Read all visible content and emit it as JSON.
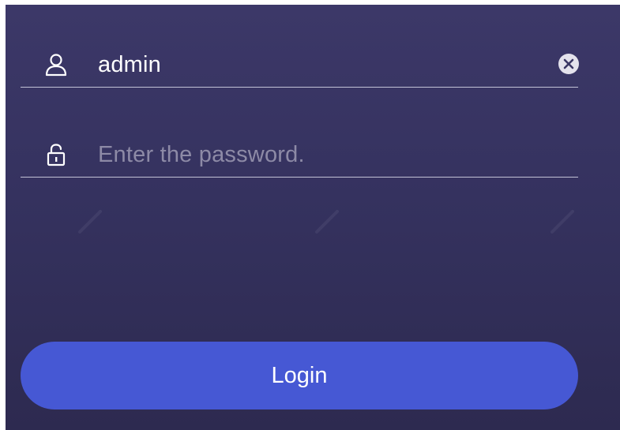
{
  "login_form": {
    "username": {
      "value": "admin",
      "icon": "user-icon",
      "clear_icon": "clear-icon"
    },
    "password": {
      "placeholder": "Enter the password.",
      "value": "",
      "icon": "lock-icon"
    },
    "login_button_label": "Login"
  },
  "colors": {
    "background_top": "#3c3868",
    "background_bottom": "#2d2a50",
    "button": "#4658d4",
    "underline": "#dcdceb",
    "placeholder": "#8d8aa6"
  }
}
